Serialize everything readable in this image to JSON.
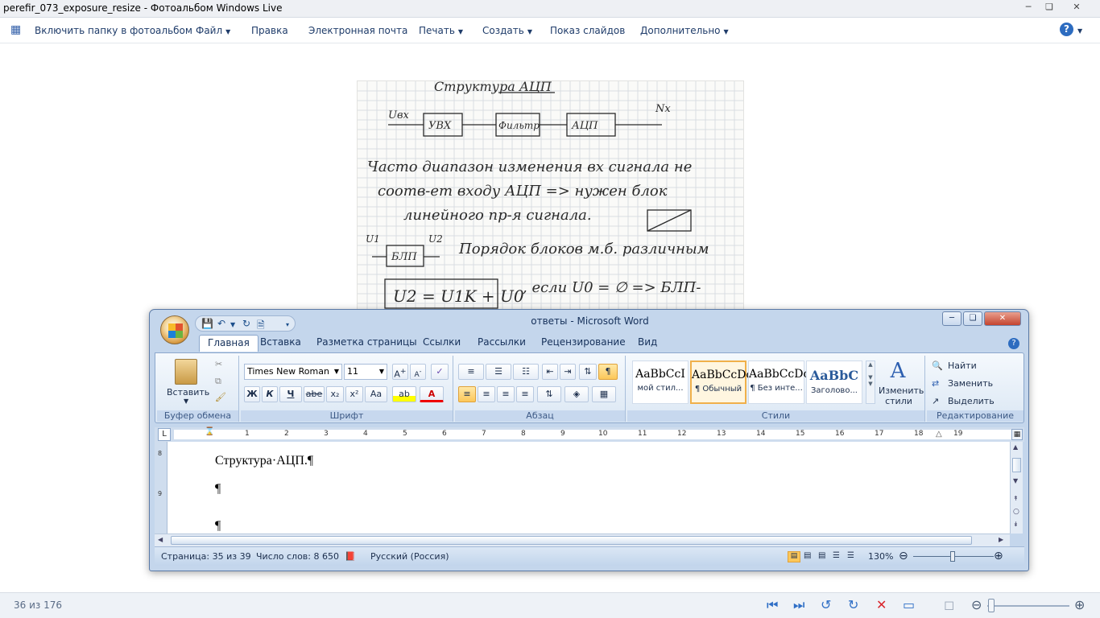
{
  "gallery": {
    "title": "perefir_073_exposure_resize - Фотоальбом Windows Live",
    "menu": [
      {
        "label": "Включить папку в фотоальбом"
      },
      {
        "label": "Файл",
        "dropdown": true
      },
      {
        "label": "Правка"
      },
      {
        "label": "Электронная почта"
      },
      {
        "label": "Печать",
        "dropdown": true
      },
      {
        "label": "Создать",
        "dropdown": true
      },
      {
        "label": "Показ слайдов"
      },
      {
        "label": "Дополнительно",
        "dropdown": true
      }
    ],
    "counter": "36 из 176",
    "photo_text": {
      "title": "Структура АЦП",
      "block1": "УВХ",
      "block2": "Фильтр",
      "block3": "АЦП",
      "input": "Uвх",
      "output": "Nx",
      "line1": "Часто диапазон изменения вх сигнала не",
      "line2": "соотв-ет входу АЦП => нужен блок",
      "line3": "линейного пр-я сигнала.",
      "blp": "БЛП",
      "u1": "U1",
      "u2": "U2",
      "line4": "Порядок блоков м.б. различным",
      "formula": "U2 = U1K + U0",
      "line5": ", если U0 = ∅ => БЛП-"
    }
  },
  "word": {
    "title": "ответы - Microsoft Word",
    "tabs": [
      "Главная",
      "Вставка",
      "Разметка страницы",
      "Ссылки",
      "Рассылки",
      "Рецензирование",
      "Вид"
    ],
    "groups": {
      "clipboard": "Буфер обмена",
      "font": "Шрифт",
      "paragraph": "Абзац",
      "styles": "Стили",
      "editing": "Редактирование"
    },
    "paste_label": "Вставить",
    "font_name": "Times New Roman",
    "font_size": "11",
    "format_buttons": [
      "Ж",
      "К",
      "Ч",
      "abe",
      "x₂",
      "x²",
      "Aa"
    ],
    "styles": [
      {
        "sample": "AaBbCcI",
        "name": "мой стил..."
      },
      {
        "sample": "AaBbCcDc",
        "name": "¶ Обычный"
      },
      {
        "sample": "AaBbCcDc",
        "name": "¶ Без инте..."
      },
      {
        "sample": "AaBbC",
        "name": "Заголово..."
      }
    ],
    "change_styles": "Изменить стили",
    "find": "Найти",
    "replace": "Заменить",
    "select": "Выделить",
    "ruler_numbers": [
      "1",
      "2",
      "3",
      "4",
      "5",
      "6",
      "7",
      "8",
      "9",
      "10",
      "11",
      "12",
      "13",
      "14",
      "15",
      "16",
      "17",
      "18",
      "19"
    ],
    "doc_lines": [
      "Структура·АЦП.¶",
      "¶",
      "¶"
    ],
    "status": {
      "page": "Страница: 35 из 39",
      "words": "Число слов: 8 650",
      "language": "Русский (Россия)",
      "zoom": "130%"
    }
  }
}
